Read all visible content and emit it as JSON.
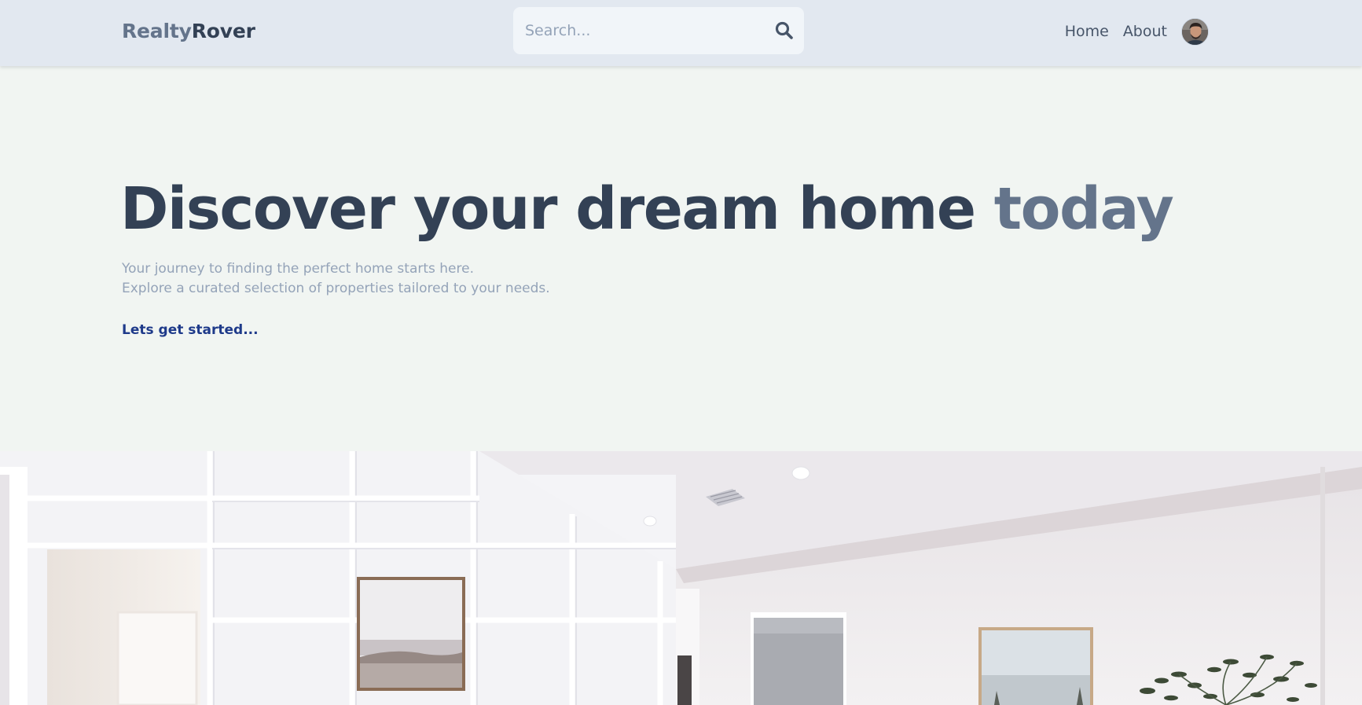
{
  "header": {
    "logo": {
      "part1": "Realty",
      "part2": "Rover"
    },
    "search": {
      "placeholder": "Search..."
    },
    "nav": [
      {
        "label": "Home"
      },
      {
        "label": "About"
      }
    ]
  },
  "hero": {
    "title": "Discover your dream home",
    "title_accent": "today",
    "subtitle_line1": "Your journey to finding the perfect home starts here.",
    "subtitle_line2": "Explore a curated selection of properties tailored to your needs.",
    "cta": "Lets get started..."
  },
  "icons": {
    "search": "search-icon",
    "avatar": "user-avatar"
  },
  "colors": {
    "header_bg": "#e2e8f0",
    "page_bg": "#f1f5f2",
    "title": "#334155",
    "accent": "#64748b",
    "subtitle": "#94a3b8",
    "cta": "#1e3a8a"
  }
}
